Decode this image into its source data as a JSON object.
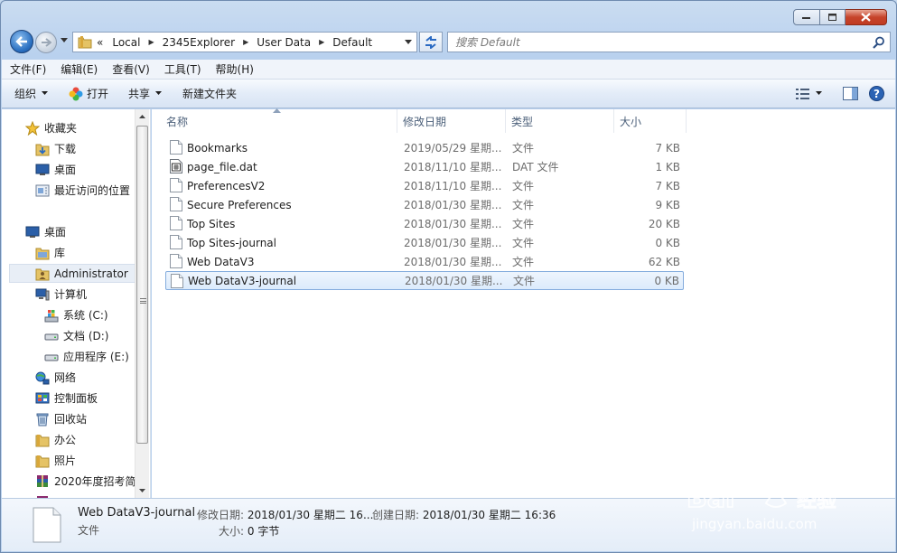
{
  "address": {
    "overflow": "«",
    "segments": [
      "Local",
      "2345Explorer",
      "User Data",
      "Default"
    ]
  },
  "search": {
    "placeholder": "搜索 Default"
  },
  "menu": [
    "文件(F)",
    "编辑(E)",
    "查看(V)",
    "工具(T)",
    "帮助(H)"
  ],
  "toolbar": {
    "organize": "组织",
    "open": "打开",
    "share": "共享",
    "new_folder": "新建文件夹"
  },
  "nav": {
    "favorites": "收藏夹",
    "downloads": "下载",
    "desktop_fav": "桌面",
    "recent": "最近访问的位置",
    "desktop": "桌面",
    "libraries": "库",
    "user": "Administrator",
    "computer": "计算机",
    "drive_c": "系统 (C:)",
    "drive_d": "文档 (D:)",
    "drive_e": "应用程序 (E:)",
    "network": "网络",
    "control_panel": "控制面板",
    "recycle": "回收站",
    "office": "办公",
    "photos": "照片",
    "archive": "2020年度招考简"
  },
  "columns": {
    "name": "名称",
    "date": "修改日期",
    "type": "类型",
    "size": "大小"
  },
  "files": [
    {
      "name": "Bookmarks",
      "date": "2019/05/29 星期...",
      "type": "文件",
      "size": "7 KB",
      "icon": "file-icon"
    },
    {
      "name": "page_file.dat",
      "date": "2018/11/10 星期...",
      "type": "DAT 文件",
      "size": "1 KB",
      "icon": "dat-file-icon"
    },
    {
      "name": "PreferencesV2",
      "date": "2018/11/10 星期...",
      "type": "文件",
      "size": "7 KB",
      "icon": "file-icon"
    },
    {
      "name": "Secure Preferences",
      "date": "2018/01/30 星期...",
      "type": "文件",
      "size": "9 KB",
      "icon": "file-icon"
    },
    {
      "name": "Top Sites",
      "date": "2018/01/30 星期...",
      "type": "文件",
      "size": "20 KB",
      "icon": "file-icon"
    },
    {
      "name": "Top Sites-journal",
      "date": "2018/01/30 星期...",
      "type": "文件",
      "size": "0 KB",
      "icon": "file-icon"
    },
    {
      "name": "Web DataV3",
      "date": "2018/01/30 星期...",
      "type": "文件",
      "size": "62 KB",
      "icon": "file-icon"
    },
    {
      "name": "Web DataV3-journal",
      "date": "2018/01/30 星期...",
      "type": "文件",
      "size": "0 KB",
      "icon": "file-icon",
      "selected": true
    }
  ],
  "details": {
    "name": "Web DataV3-journal",
    "type": "文件",
    "modified_label": "修改日期:",
    "modified": "2018/01/30 星期二 16...",
    "created_label": "创建日期:",
    "created": "2018/01/30 星期二 16:36",
    "size_label": "大小:",
    "size": "0 字节"
  },
  "watermark": {
    "brand": "Bai du 经验",
    "url": "jingyan.baidu.com"
  }
}
